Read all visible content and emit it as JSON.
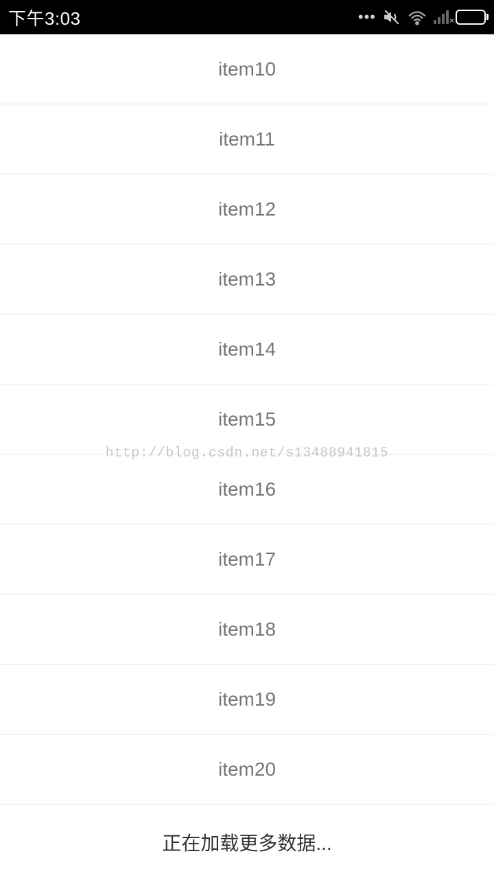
{
  "statusBar": {
    "time": "下午3:03"
  },
  "list": {
    "items": [
      "item10",
      "item11",
      "item12",
      "item13",
      "item14",
      "item15",
      "item16",
      "item17",
      "item18",
      "item19",
      "item20"
    ]
  },
  "footer": {
    "loadingText": "正在加载更多数据..."
  },
  "watermark": "http://blog.csdn.net/s13488941815"
}
